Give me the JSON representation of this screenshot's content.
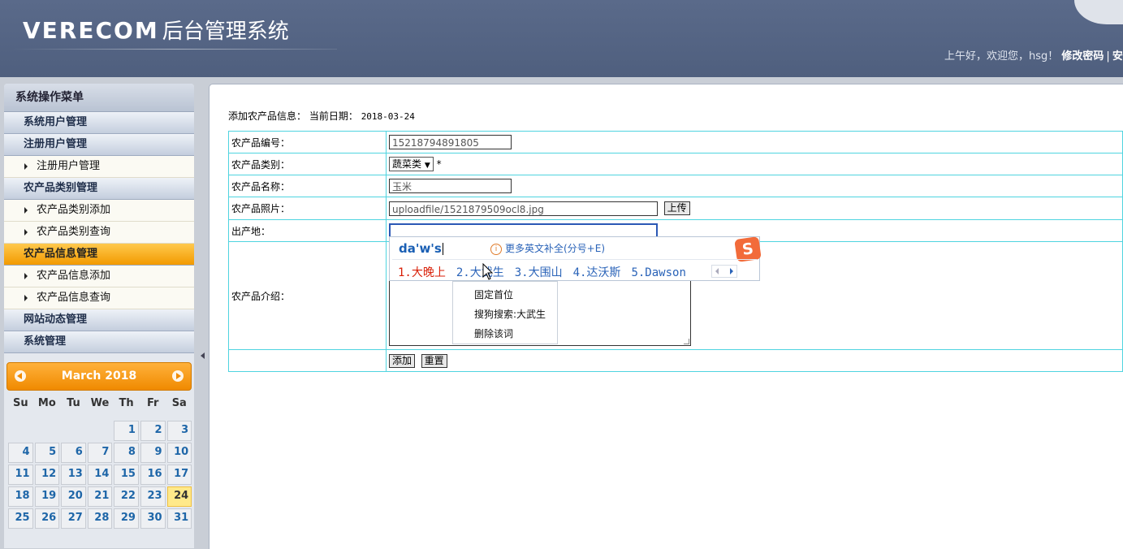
{
  "header": {
    "logo_text": "VERECOM",
    "logo_sub": "后台管理系统",
    "greeting": "上午好，欢迎您，hsg！",
    "change_password": "修改密码",
    "separator": "|",
    "truncated_link": "安"
  },
  "sidebar": {
    "title": "系统操作菜单",
    "groups": [
      {
        "label": "系统用户管理"
      },
      {
        "label": "注册用户管理",
        "items": [
          "注册用户管理"
        ]
      },
      {
        "label": "农产品类别管理",
        "items": [
          "农产品类别添加",
          "农产品类别查询"
        ]
      },
      {
        "label": "农产品信息管理",
        "active": true,
        "items": [
          "农产品信息添加",
          "农产品信息查询"
        ]
      },
      {
        "label": "网站动态管理"
      },
      {
        "label": "系统管理"
      }
    ]
  },
  "calendar": {
    "month_label": "March 2018",
    "weekdays": [
      "Su",
      "Mo",
      "Tu",
      "We",
      "Th",
      "Fr",
      "Sa"
    ],
    "leading_blanks": 4,
    "days": 31,
    "today": 24
  },
  "main": {
    "crumb_label": "添加农产品信息：",
    "date_label": "当前日期：",
    "date_value": "2018-03-24",
    "fields": {
      "code_label": "农产品编号：",
      "code_value": "15218794891805",
      "category_label": "农产品类别：",
      "category_value": "蔬菜类",
      "required_mark": "*",
      "name_label": "农产品名称：",
      "name_value": "玉米",
      "photo_label": "农产品照片：",
      "photo_value": "uploadfile/1521879509ocl8.jpg",
      "upload_button": "上传",
      "origin_label": "出产地：",
      "origin_value": "",
      "intro_label": "农产品介绍："
    },
    "buttons": {
      "add": "添加",
      "reset": "重置"
    }
  },
  "ime": {
    "input": "da'w's",
    "hint": "更多英文补全(分号+E)",
    "logo": "S",
    "candidates": [
      "1.大晚上",
      "2.大武生",
      "3.大围山",
      "4.达沃斯",
      "5.Dawson"
    ]
  },
  "context_menu": {
    "items": [
      "固定首位",
      "搜狗搜索:大武生",
      "删除该词"
    ]
  },
  "colors": {
    "header_bg": "#55658a",
    "active_menu": "#f5a30f",
    "table_border": "#4fd4e0",
    "calendar_head": "#f39a14",
    "candidate_first": "#d81e06"
  }
}
